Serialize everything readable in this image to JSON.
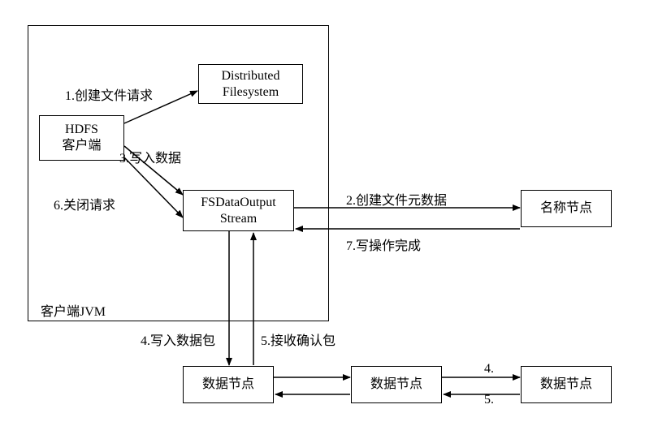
{
  "jvm_label": "客户端JVM",
  "boxes": {
    "client": {
      "line1": "HDFS",
      "line2": "客户端"
    },
    "dfs": {
      "line1": "Distributed",
      "line2": "Filesystem"
    },
    "stream": {
      "line1": "FSDataOutput",
      "line2": "Stream"
    },
    "name": "名称节点",
    "dn1": "数据节点",
    "dn2": "数据节点",
    "dn3": "数据节点"
  },
  "labels": {
    "l1": "1.创建文件请求",
    "l3": "3.写入数据",
    "l6": "6.关闭请求",
    "l2": "2.创建文件元数据",
    "l7": "7.写操作完成",
    "l4": "4.写入数据包",
    "l5": "5.接收确认包",
    "l4b": "4.",
    "l5b": "5."
  }
}
